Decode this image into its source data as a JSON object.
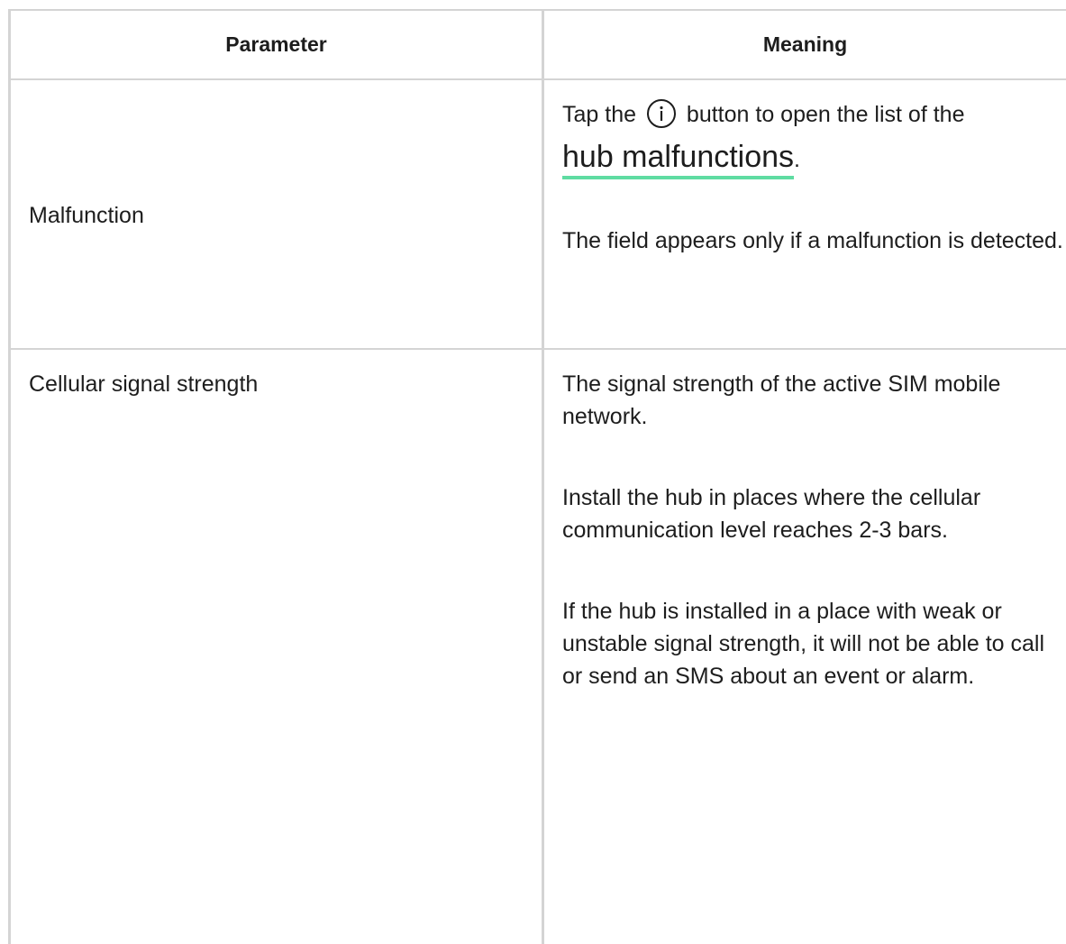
{
  "table": {
    "headers": {
      "parameter": "Parameter",
      "meaning": "Meaning"
    },
    "rows": [
      {
        "parameter": "Malfunction",
        "meaning": {
          "tap_prefix": "Tap the",
          "icon": "info-circle-icon",
          "tap_suffix": "button to open the list of the",
          "link_text": "hub malfunctions",
          "link_period": ".",
          "note": "The field appears only if a malfunction is detected."
        }
      },
      {
        "parameter": "Cellular signal strength",
        "meaning": {
          "p1": "The signal strength of the active SIM mobile network.",
          "p2": "Install the hub in places where the cellular communication level reaches 2-3 bars.",
          "p3": "If the hub is installed in a place with weak or unstable signal strength, it will not be able to call or send an SMS about an event or alarm."
        }
      }
    ]
  },
  "colors": {
    "link_underline": "#5fdca2",
    "grid_line": "#d4d4d4",
    "text": "#1d1d1d"
  }
}
